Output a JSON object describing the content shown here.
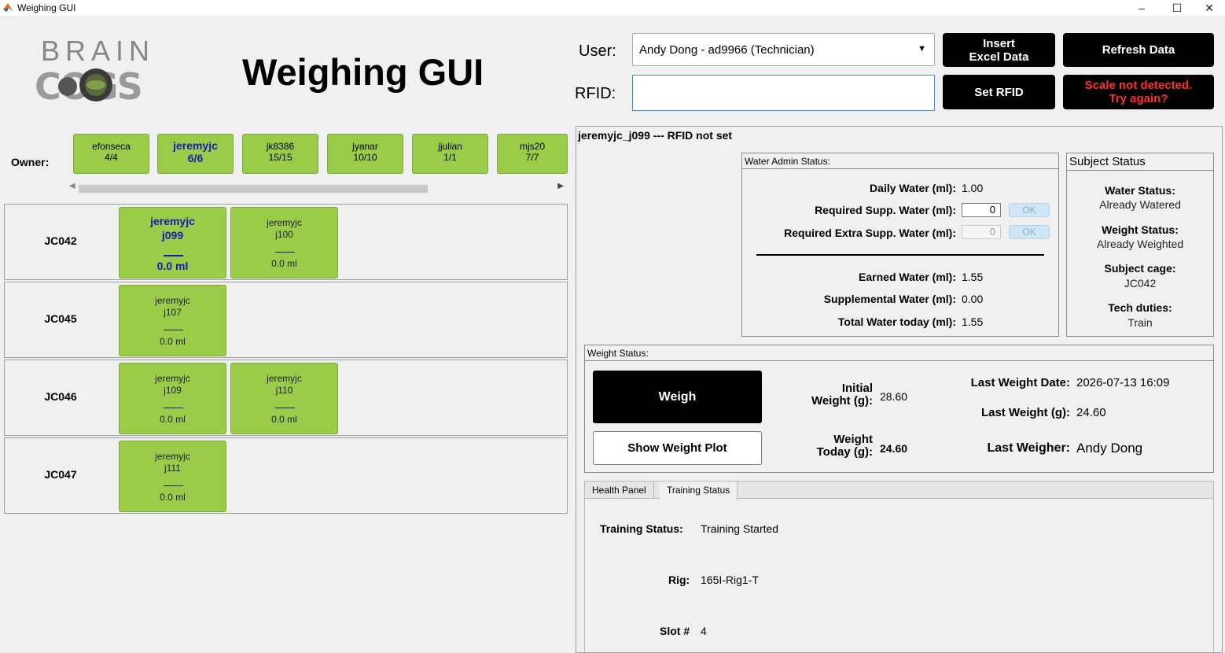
{
  "window": {
    "title": "Weighing GUI"
  },
  "logo": {
    "text": "BRAIN",
    "subtext": "COGS"
  },
  "app_title": "Weighing GUI",
  "user": {
    "label": "User:",
    "selected": "Andy Dong - ad9966 (Technician)"
  },
  "rfid": {
    "label": "RFID:",
    "value": ""
  },
  "buttons": {
    "insert_excel": "Insert\nExcel Data",
    "refresh": "Refresh Data",
    "set_rfid": "Set RFID",
    "scale_status": "Scale not detected.\nTry again?"
  },
  "owner": {
    "label": "Owner:",
    "tabs": [
      {
        "name": "efonseca",
        "count": "4/4"
      },
      {
        "name": "jeremyjc",
        "count": "6/6",
        "selected": true
      },
      {
        "name": "jk8386",
        "count": "15/15"
      },
      {
        "name": "jyanar",
        "count": "10/10"
      },
      {
        "name": "jjulian",
        "count": "1/1"
      },
      {
        "name": "mjs20",
        "count": "7/7"
      }
    ]
  },
  "cages": [
    {
      "label": "JC042",
      "subjects": [
        {
          "owner": "jeremyjc",
          "id": "j099",
          "water": "0.0 ml",
          "selected": true
        },
        {
          "owner": "jeremyjc",
          "id": "j100",
          "water": "0.0 ml"
        }
      ]
    },
    {
      "label": "JC045",
      "subjects": [
        {
          "owner": "jeremyjc",
          "id": "j107",
          "water": "0.0 ml"
        }
      ]
    },
    {
      "label": "JC046",
      "subjects": [
        {
          "owner": "jeremyjc",
          "id": "j109",
          "water": "0.0 ml"
        },
        {
          "owner": "jeremyjc",
          "id": "j110",
          "water": "0.0 ml"
        }
      ]
    },
    {
      "label": "JC047",
      "subjects": [
        {
          "owner": "jeremyjc",
          "id": "j111",
          "water": "0.0 ml"
        }
      ]
    }
  ],
  "panel_header": "jeremyjc_j099   --- RFID not set",
  "water_admin": {
    "title": "Water Admin Status:",
    "daily_label": "Daily Water (ml):",
    "daily_value": "1.00",
    "req_supp_label": "Required Supp. Water (ml):",
    "req_supp_value": "0",
    "req_extra_label": "Required Extra Supp. Water (ml):",
    "req_extra_value": "0",
    "ok_label": "OK",
    "earned_label": "Earned Water (ml):",
    "earned_value": "1.55",
    "supplemental_label": "Supplemental Water (ml):",
    "supplemental_value": "0.00",
    "total_label": "Total Water today (ml):",
    "total_value": "1.55"
  },
  "subject_status": {
    "title": "Subject Status",
    "water_label": "Water Status:",
    "water_value": "Already Watered",
    "weight_label": "Weight Status:",
    "weight_value": "Already Weighted",
    "cage_label": "Subject cage:",
    "cage_value": "JC042",
    "duties_label": "Tech duties:",
    "duties_value": "Train"
  },
  "weight_status": {
    "title": "Weight Status:",
    "weigh_button": "Weigh",
    "plot_button": "Show Weight Plot",
    "initial_label": "Initial\nWeight (g):",
    "initial_value": "28.60",
    "today_label": "Weight\nToday (g):",
    "today_value": "24.60",
    "last_date_label": "Last Weight Date:",
    "last_date_value": "2026-07-13  16:09",
    "last_weight_label": "Last Weight (g):",
    "last_weight_value": "24.60",
    "last_weigher_label": "Last Weigher:",
    "last_weigher_value": "Andy Dong"
  },
  "tabs": [
    {
      "label": "Health Panel"
    },
    {
      "label": "Training Status",
      "selected": true
    }
  ],
  "training": {
    "status_label": "Training Status:",
    "status_value": "Training Started",
    "rig_label": "Rig:",
    "rig_value": "165I-Rig1-T",
    "slot_label": "Slot #",
    "slot_value": "4"
  },
  "colors": {
    "green": "#9acc4a",
    "selected_text": "#1a1ab0",
    "alert_text": "#ff3030"
  }
}
